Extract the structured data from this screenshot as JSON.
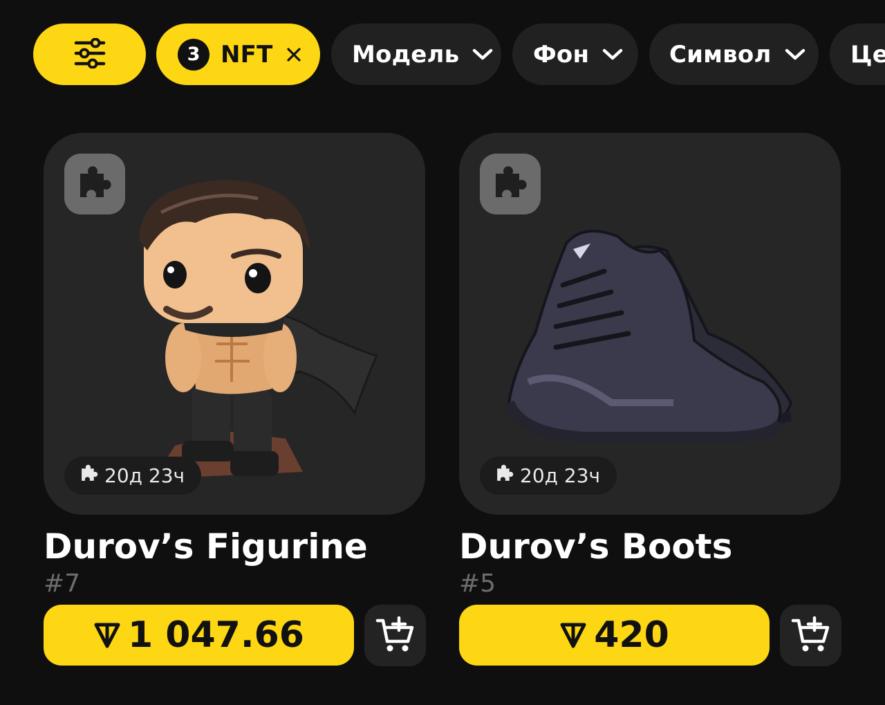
{
  "filters": {
    "settings_icon": "sliders-icon",
    "nft_count": "3",
    "nft_label": "NFT",
    "model_label": "Модель",
    "background_label": "Фон",
    "symbol_label": "Символ",
    "price_label": "Це"
  },
  "colors": {
    "accent": "#fdd614",
    "background": "#0f0f0f",
    "card": "#262626",
    "chip_dark": "#212121",
    "muted_text": "#6d6d6d"
  },
  "items": [
    {
      "name": "Durov’s Figurine",
      "number": "#7",
      "timer": "20д 23ч",
      "price": "1 047.66",
      "currency_icon": "ton-icon",
      "cart_icon": "add-to-cart-icon"
    },
    {
      "name": "Durov’s Boots",
      "number": "#5",
      "timer": "20д 23ч",
      "price": "420",
      "currency_icon": "ton-icon",
      "cart_icon": "add-to-cart-icon"
    }
  ]
}
